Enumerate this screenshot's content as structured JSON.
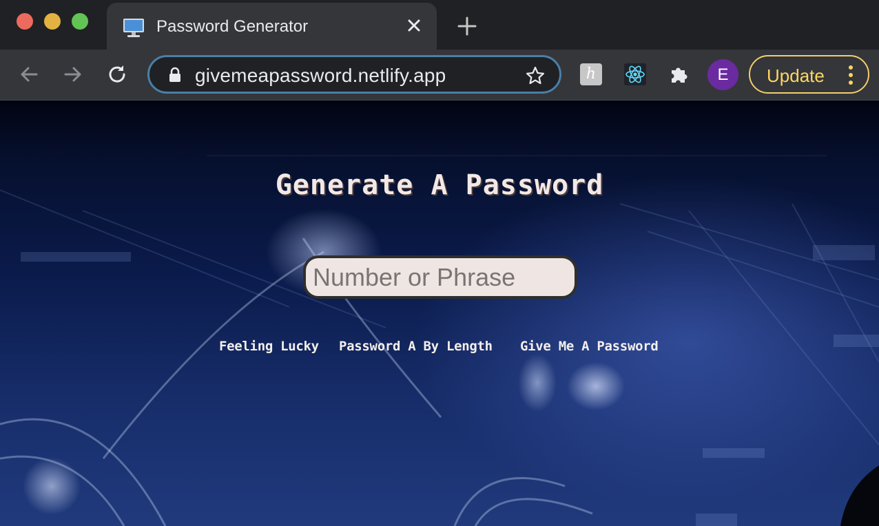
{
  "browser": {
    "tab": {
      "title": "Password Generator",
      "favicon": "monitor-icon",
      "close_icon": "close-icon"
    },
    "new_tab_icon": "plus-icon",
    "toolbar": {
      "back_icon": "arrow-left-icon",
      "forward_icon": "arrow-right-icon",
      "reload_icon": "reload-icon",
      "url": "givemeapassword.netlify.app",
      "lock_icon": "lock-icon",
      "bookmark_icon": "star-icon",
      "extensions": [
        "hunter-extension-icon",
        "react-devtools-icon",
        "puzzle-icon"
      ],
      "profile_initial": "E",
      "update_label": "Update",
      "menu_icon": "kebab-menu-icon"
    },
    "colors": {
      "accent_update": "#fdd663",
      "profile": "#6a2aa0",
      "omnibox_focus": "#4a7fa8"
    }
  },
  "page": {
    "title": "Generate A Password",
    "input": {
      "placeholder": "Number or Phrase",
      "value": ""
    },
    "buttons": {
      "feeling_lucky": "Feeling Lucky",
      "by_length": "Password A By Length",
      "give_me": "Give Me A Password"
    }
  }
}
